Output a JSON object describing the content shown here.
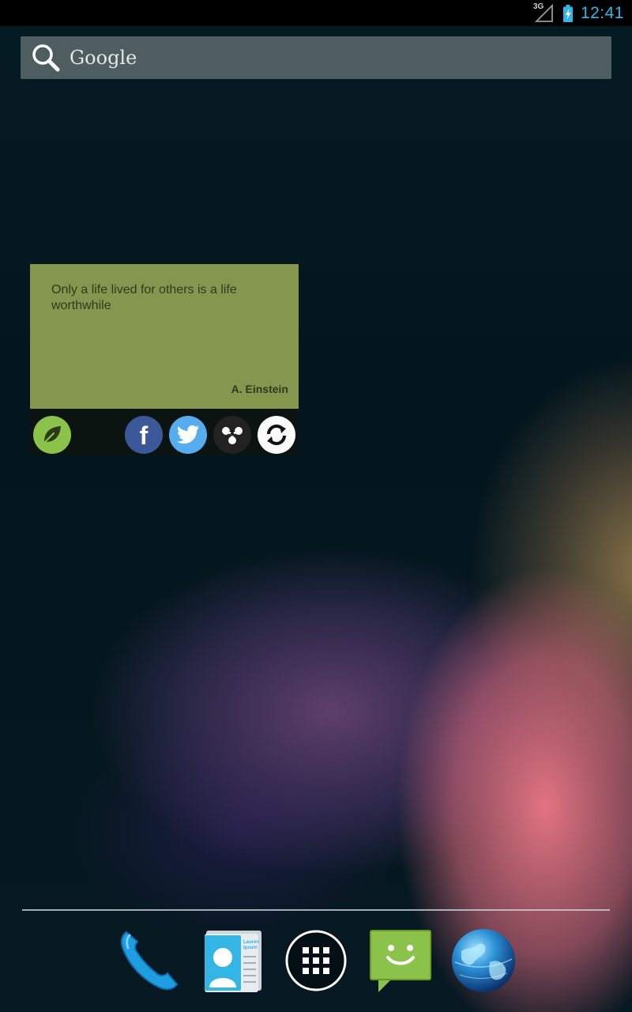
{
  "statusbar": {
    "network_label": "3G",
    "time": "12:41",
    "colors": {
      "clock": "#33b5e5"
    }
  },
  "search": {
    "placeholder": "Google",
    "icon": "search-icon"
  },
  "quote_widget": {
    "text": "Only a life lived for others is a life worthwhile",
    "author": "A. Einstein",
    "card_color": "#85974e",
    "actions": [
      {
        "name": "app-leaf",
        "icon": "leaf-icon"
      },
      {
        "name": "facebook",
        "icon": "facebook-icon"
      },
      {
        "name": "twitter",
        "icon": "twitter-icon"
      },
      {
        "name": "share",
        "icon": "share-icon"
      },
      {
        "name": "refresh",
        "icon": "refresh-icon"
      }
    ]
  },
  "dock": {
    "items": [
      {
        "name": "phone",
        "icon": "phone-icon"
      },
      {
        "name": "people",
        "icon": "contacts-icon",
        "card_text": "Lauren Ipsum"
      },
      {
        "name": "apps",
        "icon": "app-drawer-icon"
      },
      {
        "name": "messaging",
        "icon": "messaging-icon"
      },
      {
        "name": "browser",
        "icon": "globe-icon"
      }
    ]
  }
}
